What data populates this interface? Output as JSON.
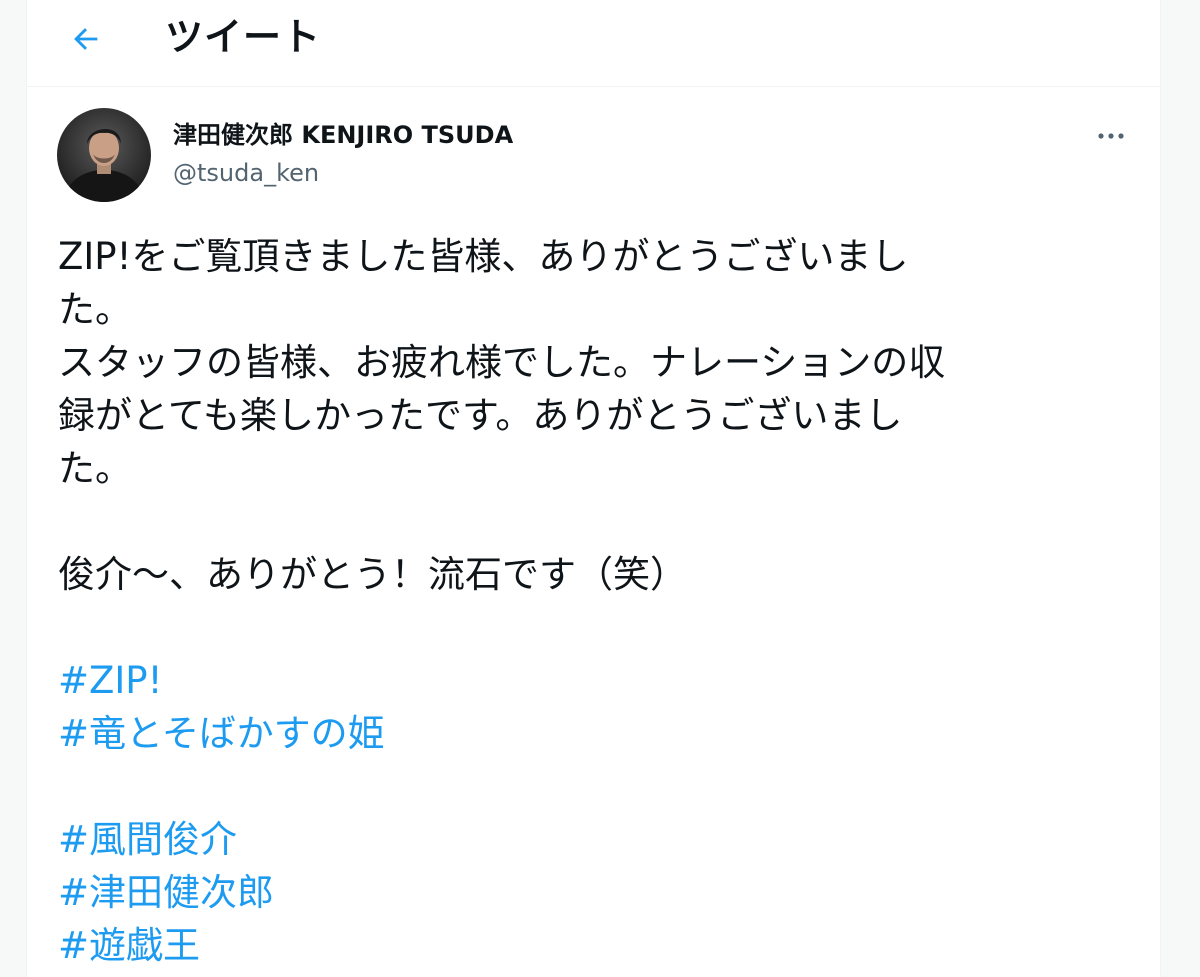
{
  "header": {
    "title": "ツイート",
    "back_icon": "arrow-left-icon"
  },
  "tweet": {
    "author": {
      "display_name": "津田健次郎 KENJIRO TSUDA",
      "handle": "@tsuda_ken"
    },
    "text_lines": [
      "ZIP!をご覧頂きました皆様、ありがとうございまし",
      "た。",
      "スタッフの皆様、お疲れ様でした。ナレーションの収",
      "録がとても楽しかったです。ありがとうございまし",
      "た。",
      "俊介〜、ありがとう！流石です（笑）"
    ],
    "hashtags_group1": [
      "#ZIP!",
      "#竜とそばかすの姫"
    ],
    "hashtags_group2": [
      "#風間俊介",
      "#津田健次郎",
      "#遊戯王"
    ],
    "more_icon": "more-horizontal-icon"
  },
  "colors": {
    "accent": "#1d9bf0",
    "text": "#0f1419",
    "secondary_text": "#536471"
  }
}
